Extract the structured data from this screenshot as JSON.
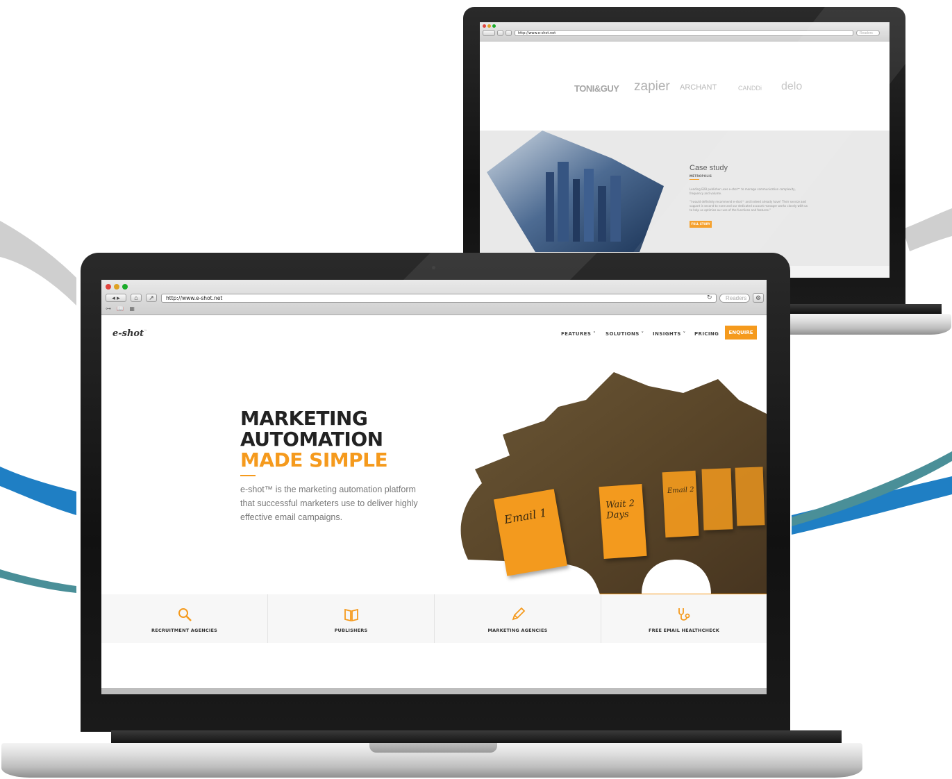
{
  "front": {
    "browser": {
      "url": "http://www.e-shot.net",
      "search_placeholder": "Readers"
    },
    "site": {
      "logo": "e-shot",
      "logo_mark": "™",
      "nav": [
        {
          "label": "FEATURES ˅"
        },
        {
          "label": "SOLUTIONS ˅"
        },
        {
          "label": "INSIGHTS ˅"
        },
        {
          "label": "PRICING"
        }
      ],
      "enquire_label": "ENQUIRE",
      "hero": {
        "line1": "MARKETING",
        "line2": "AUTOMATION",
        "line3": "MADE SIMPLE",
        "body": "e-shot™ is the marketing automation platform that successful marketers use to deliver highly effective email campaigns."
      },
      "notes": [
        "Email 1",
        "Wait 2 Days",
        "Email 2",
        "",
        ""
      ],
      "tiles": [
        {
          "label": "RECRUITMENT AGENCIES",
          "icon": "magnifier-icon"
        },
        {
          "label": "PUBLISHERS",
          "icon": "book-icon"
        },
        {
          "label": "MARKETING AGENCIES",
          "icon": "pencil-icon"
        },
        {
          "label": "FREE EMAIL HEALTHCHECK",
          "icon": "stethoscope-icon"
        }
      ]
    }
  },
  "back": {
    "browser": {
      "url": "http://www.e-shot.net",
      "search_placeholder": "Readers"
    },
    "site": {
      "brands": [
        "TONI&GUY",
        "zapier",
        "ARCHANT",
        "CANDDi",
        "delo"
      ],
      "case_study": {
        "title": "Case study",
        "subtitle": "METROPOLIS",
        "para1": "Leading B2B publisher uses e-shot™ to manage communication complexity, frequency and volume.",
        "para2": "\"I would definitely recommend e-shot™ and indeed already have! Their service and support is second to none and our dedicated account manager works closely with us to help us optimise our use of the functions and features.\"",
        "button": "FULL STORY"
      }
    }
  },
  "colors": {
    "accent": "#f59a1d",
    "swoosh_blue": "#1f7fc4",
    "swoosh_teal": "#4a8f98",
    "swoosh_grey": "#cfcfcf"
  }
}
